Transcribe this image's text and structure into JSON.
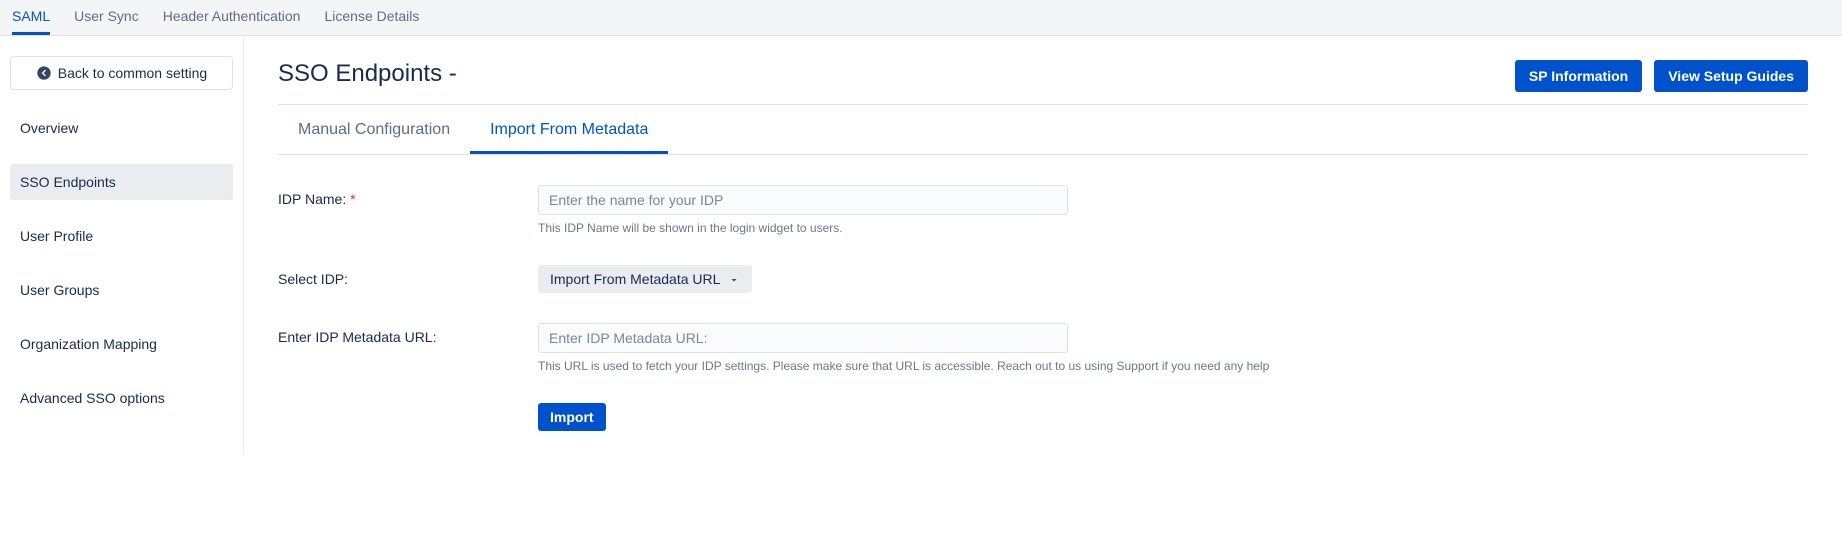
{
  "topnav": {
    "items": [
      {
        "label": "SAML",
        "active": true
      },
      {
        "label": "User Sync",
        "active": false
      },
      {
        "label": "Header Authentication",
        "active": false
      },
      {
        "label": "License Details",
        "active": false
      }
    ]
  },
  "sidebar": {
    "back_label": "Back to common setting",
    "items": [
      {
        "label": "Overview",
        "active": false
      },
      {
        "label": "SSO Endpoints",
        "active": true
      },
      {
        "label": "User Profile",
        "active": false
      },
      {
        "label": "User Groups",
        "active": false
      },
      {
        "label": "Organization Mapping",
        "active": false
      },
      {
        "label": "Advanced SSO options",
        "active": false
      }
    ]
  },
  "header": {
    "title": "SSO Endpoints -",
    "actions": {
      "sp_info": "SP Information",
      "view_guides": "View Setup Guides"
    }
  },
  "inner_tabs": [
    {
      "label": "Manual Configuration",
      "active": false
    },
    {
      "label": "Import From Metadata",
      "active": true
    }
  ],
  "form": {
    "idp_name": {
      "label": "IDP Name:",
      "required_mark": "*",
      "placeholder": "Enter the name for your IDP",
      "help": "This IDP Name will be shown in the login widget to users."
    },
    "select_idp": {
      "label": "Select IDP:",
      "selected": "Import From Metadata URL"
    },
    "metadata_url": {
      "label": "Enter IDP Metadata URL:",
      "placeholder": "Enter IDP Metadata URL:",
      "help": "This URL is used to fetch your IDP settings. Please make sure that URL is accessible. Reach out to us using Support if you need any help"
    },
    "submit_label": "Import"
  }
}
